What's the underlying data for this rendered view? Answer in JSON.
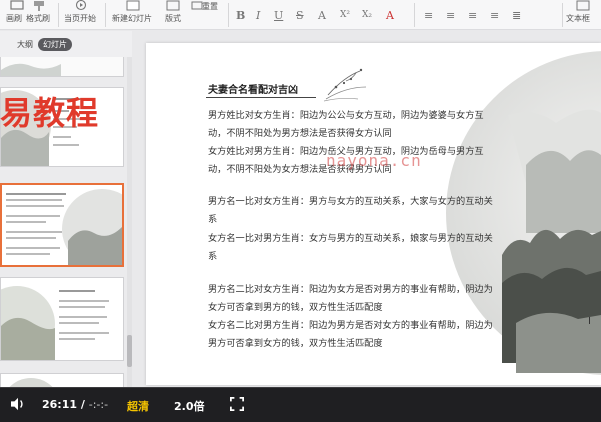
{
  "ribbon": {
    "items": [
      {
        "label": "画刷",
        "icon": "brush-icon"
      },
      {
        "label": "格式刷",
        "icon": "format-painter-icon"
      },
      {
        "label": "当页开始",
        "icon": "play-from-current-icon"
      },
      {
        "label": "新建幻灯片",
        "icon": "new-slide-icon"
      },
      {
        "label": "版式",
        "icon": "layout-icon"
      },
      {
        "label": "重置",
        "icon": "reset-icon"
      },
      {
        "label": "文本框",
        "icon": "textbox-icon"
      }
    ]
  },
  "panel": {
    "tab_outline": "大纲",
    "tab_slides": "幻灯片"
  },
  "overlay": {
    "title_fragment": "易教程"
  },
  "slide": {
    "title": "夫妻合名看配对吉凶",
    "paragraphs": [
      "男方姓比对女方生肖：阳边为公公与女方互动，阴边为婆婆与女方互动，不阴不阳处为男方想法是否获得女方认同",
      "女方姓比对男方生肖：阳边为岳父与男方互动，阴边为岳母与男方互动，不阴不阳处为女方想法是否获得男方认同",
      "男方名一比对女方生肖：男方与女方的互动关系，大家与女方的互动关系",
      "女方名一比对男方生肖：女方与男方的互动关系，娘家与男方的互动关系",
      "男方名二比对女方生肖：阳边为女方是否对男方的事业有帮助，阴边为女方可否拿到男方的钱，双方性生活匹配度",
      "女方名二比对男方生肖：阳边为男方是否对女方的事业有帮助，阴边为男方可否拿到女方的钱，双方性生活匹配度"
    ],
    "watermark": "nayona.cn"
  },
  "player": {
    "current_time": "26:11",
    "separator": "/",
    "duration": "-:-:-",
    "quality": "超清",
    "speed": "2.0倍"
  },
  "colors": {
    "accent_orange": "#e8703a",
    "overlay_red": "#e03a2b",
    "quality_yellow": "#f4c300",
    "player_bg": "#1f1f22"
  }
}
